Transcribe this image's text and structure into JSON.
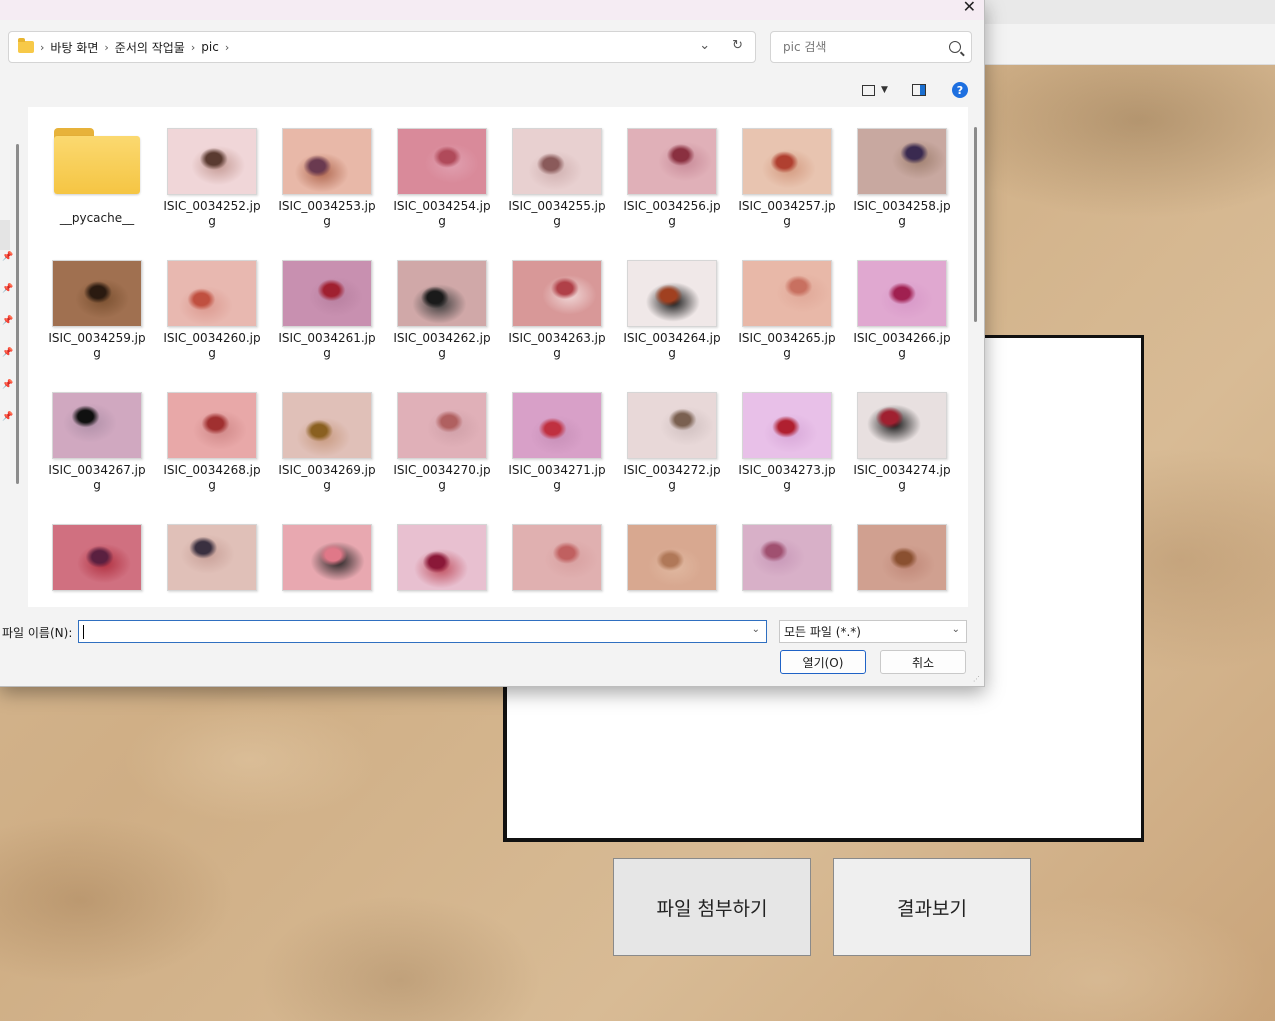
{
  "dialog": {
    "breadcrumb": [
      "바탕 화면",
      "준서의 작업물",
      "pic"
    ],
    "search_placeholder": "pic 검색",
    "help_glyph": "?",
    "filename_label": "파일 이름(N):",
    "filename_value": "",
    "filetype_value": "모든 파일 (*.*)",
    "open_label": "열기(O)",
    "cancel_label": "취소",
    "items": [
      {
        "name": "__pycache__",
        "kind": "folder"
      },
      {
        "name": "ISIC_0034252.jpg",
        "kind": "image",
        "colors": [
          "#f0d6d8",
          "#5a3a30",
          "#c49a94"
        ]
      },
      {
        "name": "ISIC_0034253.jpg",
        "kind": "image",
        "colors": [
          "#e8b8a8",
          "#6a3a50",
          "#b06850"
        ]
      },
      {
        "name": "ISIC_0034254.jpg",
        "kind": "image",
        "colors": [
          "#d98a9a",
          "#b04a5a",
          "#e0a0b0"
        ]
      },
      {
        "name": "ISIC_0034255.jpg",
        "kind": "image",
        "colors": [
          "#e8d0d0",
          "#8a5a5a",
          "#d0b0b0"
        ]
      },
      {
        "name": "ISIC_0034256.jpg",
        "kind": "image",
        "colors": [
          "#e0b0b8",
          "#8a3040",
          "#c88a98"
        ]
      },
      {
        "name": "ISIC_0034257.jpg",
        "kind": "image",
        "colors": [
          "#e8c4b0",
          "#b04030",
          "#d49a80"
        ]
      },
      {
        "name": "ISIC_0034258.jpg",
        "kind": "image",
        "colors": [
          "#c8a8a0",
          "#3a2a50",
          "#a08070"
        ]
      },
      {
        "name": "ISIC_0034259.jpg",
        "kind": "image",
        "colors": [
          "#a07050",
          "#2a1a10",
          "#7a5030"
        ]
      },
      {
        "name": "ISIC_0034260.jpg",
        "kind": "image",
        "colors": [
          "#e8b8b0",
          "#c05040",
          "#dc9a90"
        ]
      },
      {
        "name": "ISIC_0034261.jpg",
        "kind": "image",
        "colors": [
          "#c890b0",
          "#a02030",
          "#b880a0"
        ]
      },
      {
        "name": "ISIC_0034262.jpg",
        "kind": "image",
        "colors": [
          "#d0a8a8",
          "#1a1a1a",
          "#3a3a3a"
        ]
      },
      {
        "name": "ISIC_0034263.jpg",
        "kind": "image",
        "colors": [
          "#d89898",
          "#b04048",
          "#f0d8d8"
        ]
      },
      {
        "name": "ISIC_0034264.jpg",
        "kind": "image",
        "colors": [
          "#f0e8e8",
          "#a04020",
          "#101010"
        ]
      },
      {
        "name": "ISIC_0034265.jpg",
        "kind": "image",
        "colors": [
          "#e8b8a8",
          "#c87060",
          "#e0a898"
        ]
      },
      {
        "name": "ISIC_0034266.jpg",
        "kind": "image",
        "colors": [
          "#e0a8d0",
          "#a02050",
          "#d898c8"
        ]
      },
      {
        "name": "ISIC_0034267.jpg",
        "kind": "image",
        "colors": [
          "#d0a8c0",
          "#101010",
          "#b090a8"
        ]
      },
      {
        "name": "ISIC_0034268.jpg",
        "kind": "image",
        "colors": [
          "#e8a8a8",
          "#a03030",
          "#d08888"
        ]
      },
      {
        "name": "ISIC_0034269.jpg",
        "kind": "image",
        "colors": [
          "#e0c0b8",
          "#8a6020",
          "#c89a80"
        ]
      },
      {
        "name": "ISIC_0034270.jpg",
        "kind": "image",
        "colors": [
          "#e0b0b8",
          "#b06060",
          "#d0a0a8"
        ]
      },
      {
        "name": "ISIC_0034271.jpg",
        "kind": "image",
        "colors": [
          "#d8a0c8",
          "#c03040",
          "#c890b8"
        ]
      },
      {
        "name": "ISIC_0034272.jpg",
        "kind": "image",
        "colors": [
          "#e8d8d8",
          "#7a6050",
          "#d0c0c0"
        ]
      },
      {
        "name": "ISIC_0034273.jpg",
        "kind": "image",
        "colors": [
          "#e8c0e8",
          "#b02030",
          "#d8a8d8"
        ]
      },
      {
        "name": "ISIC_0034274.jpg",
        "kind": "image",
        "colors": [
          "#e8e0e0",
          "#a02030",
          "#101010"
        ]
      },
      {
        "name": "",
        "kind": "image",
        "colors": [
          "#d07080",
          "#5a2040",
          "#b03040"
        ]
      },
      {
        "name": "",
        "kind": "image",
        "colors": [
          "#e0c0b8",
          "#3a3040",
          "#c8a098"
        ]
      },
      {
        "name": "",
        "kind": "image",
        "colors": [
          "#e8a8b0",
          "#e07888",
          "#202020"
        ]
      },
      {
        "name": "",
        "kind": "image",
        "colors": [
          "#e8c0d0",
          "#8a1838",
          "#c05060"
        ]
      },
      {
        "name": "",
        "kind": "image",
        "colors": [
          "#e0b0b0",
          "#c06060",
          "#d8a0a0"
        ]
      },
      {
        "name": "",
        "kind": "image",
        "colors": [
          "#d8a890",
          "#b07858",
          "#e0b8a0"
        ]
      },
      {
        "name": "",
        "kind": "image",
        "colors": [
          "#d8b0c8",
          "#a05070",
          "#c898b8"
        ]
      },
      {
        "name": "",
        "kind": "image",
        "colors": [
          "#d0a090",
          "#8a5030",
          "#c08878"
        ]
      }
    ]
  },
  "app": {
    "attach_label": "파일 첨부하기",
    "result_label": "결과보기"
  }
}
